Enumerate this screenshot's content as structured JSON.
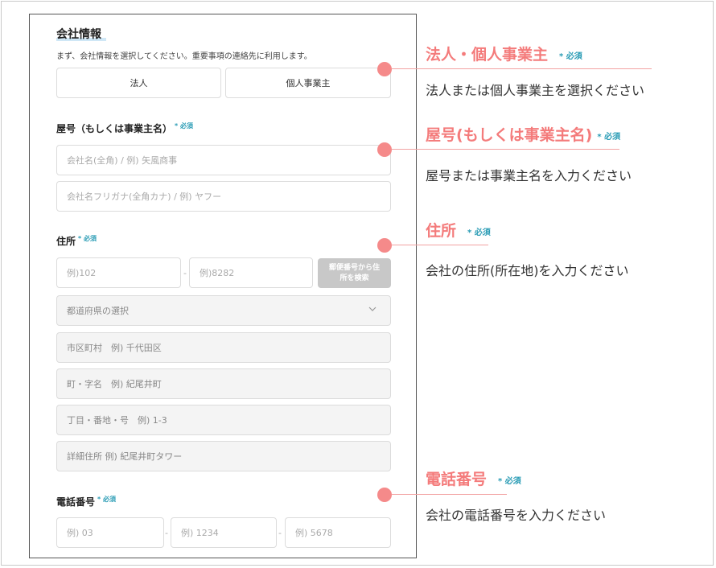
{
  "form": {
    "company_section_title": "会社情報",
    "intro_text": "まず、会社情報を選択してください。重要事項の連絡先に利用します。",
    "type_buttons": [
      "法人",
      "個人事業主"
    ],
    "trade_name_title": "屋号（もしくは事業主名）",
    "trade_name_placeholder": "会社名(全角) / 例) 矢風商事",
    "trade_name_kana_placeholder": "会社名フリガナ(全角カナ) / 例) ヤフー",
    "address_title": "住所",
    "zip1_placeholder": "例)102",
    "zip2_placeholder": "例)8282",
    "zip_dash": "-",
    "zip_search_button": "郵便番号から住所を検索",
    "prefecture_select": "都道府県の選択",
    "city_placeholder": "市区町村　例) 千代田区",
    "town_placeholder": "町・字名　例) 紀尾井町",
    "block_placeholder": "丁目・番地・号　例) 1-3",
    "detail_placeholder": "詳細住所 例) 紀尾井町タワー",
    "phone_title": "電話番号",
    "phone1_placeholder": "例) 03",
    "phone2_placeholder": "例) 1234",
    "phone3_placeholder": "例) 5678",
    "phone_dash": "-",
    "required_label": "* 必須"
  },
  "annotations": {
    "required_label": "* 必須",
    "type_title": "法人・個人事業主",
    "type_desc": "法人または個人事業主を選択ください",
    "name_title": "屋号(もしくは事業主名)",
    "name_desc": "屋号または事業主名を入力ください",
    "address_title": "住所",
    "address_desc": "会社の住所(所在地)を入力ください",
    "phone_title": "電話番号",
    "phone_desc": "会社の電話番号を入力ください"
  },
  "colors": {
    "accent": "#f47b7b",
    "required": "#2a9cb5",
    "dot": "#f58a8a"
  }
}
